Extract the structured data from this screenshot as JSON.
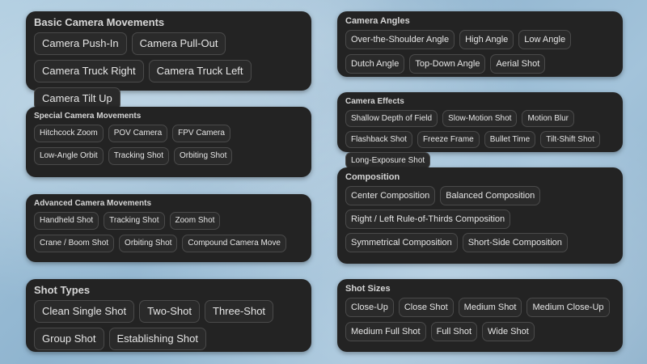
{
  "panels": {
    "basic": {
      "title": "Basic Camera Movements",
      "items": [
        "Camera Push-In",
        "Camera Pull-Out",
        "Camera Truck Right",
        "Camera Truck Left",
        "Camera Tilt Up"
      ]
    },
    "special": {
      "title": "Special Camera Movements",
      "items": [
        "Hitchcock Zoom",
        "POV Camera",
        "FPV Camera",
        "Low-Angle Orbit",
        "Tracking Shot",
        "Orbiting Shot"
      ]
    },
    "advanced": {
      "title": "Advanced Camera Movements",
      "items": [
        "Handheld Shot",
        "Tracking Shot",
        "Zoom Shot",
        "Crane / Boom Shot",
        "Orbiting Shot",
        "Compound Camera Move"
      ]
    },
    "shot_types": {
      "title": "Shot Types",
      "items": [
        "Clean Single Shot",
        "Two-Shot",
        "Three-Shot",
        "Group Shot",
        "Establishing Shot"
      ]
    },
    "angles": {
      "title": "Camera Angles",
      "items": [
        "Over-the-Shoulder Angle",
        "High Angle",
        "Low Angle",
        "Dutch Angle",
        "Top-Down Angle",
        "Aerial Shot"
      ]
    },
    "effects": {
      "title": "Camera Effects",
      "items": [
        "Shallow Depth of Field",
        "Slow-Motion Shot",
        "Motion Blur",
        "Flashback Shot",
        "Freeze Frame",
        "Bullet Time",
        "Tilt-Shift Shot",
        "Long-Exposure Shot"
      ]
    },
    "composition": {
      "title": "Composition",
      "items": [
        "Center Composition",
        "Balanced Composition",
        "Right / Left Rule-of-Thirds Composition",
        "Symmetrical Composition",
        "Short-Side Composition"
      ]
    },
    "sizes": {
      "title": "Shot Sizes",
      "items": [
        "Close-Up",
        "Close Shot",
        "Medium Shot",
        "Medium Close-Up",
        "Medium Full Shot",
        "Full Shot",
        "Wide Shot"
      ]
    }
  }
}
